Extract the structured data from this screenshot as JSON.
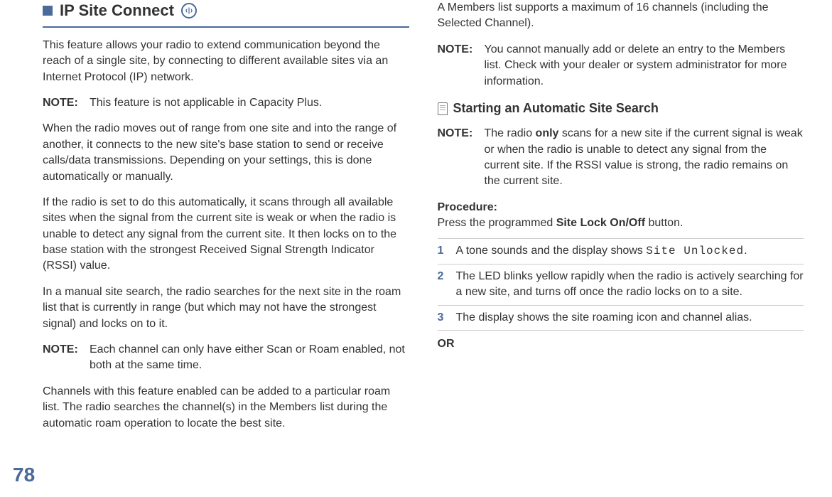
{
  "page_number": "78",
  "left": {
    "section_title": "IP Site Connect",
    "p1": "This feature allows your radio to extend communication beyond the reach of a single site, by connecting to different available sites via an Internet Protocol (IP) network.",
    "note1_label": "NOTE:",
    "note1_text": "This feature is not applicable in Capacity Plus.",
    "p2": "When the radio moves out of range from one site and into the range of another, it connects to the new site's base station to send or receive calls/data transmissions. Depending on your settings, this is done automatically or manually.",
    "p3": "If the radio is set to do this automatically, it scans through all available sites when the signal from the current site is weak or when the radio is unable to detect any signal from the current site. It then locks on to the base station with the strongest Received Signal Strength Indicator (RSSI) value.",
    "p4": "In a manual site search, the radio searches for the next site in the roam list that is currently in range (but which may not have the strongest signal) and locks on to it.",
    "note2_label": "NOTE:",
    "note2_text": "Each channel can only have either Scan or Roam enabled, not both at the same time.",
    "p5": "Channels with this feature enabled can be added to a particular roam list. The radio searches the channel(s) in the Members list during the automatic roam operation to locate the best site."
  },
  "right": {
    "p1": "A Members list supports a maximum of 16 channels (including the Selected Channel).",
    "note1_label": "NOTE:",
    "note1_text": "You cannot manually add or delete an entry to the Members list. Check with your dealer or system administrator for more information.",
    "sub_title": "Starting an Automatic Site Search",
    "note2_label": "NOTE:",
    "note2_pre": "The radio ",
    "note2_bold": "only",
    "note2_post": " scans for a new site if the current signal is weak or when the radio is unable to detect any signal from the current site. If the RSSI value is strong, the radio remains on the current site.",
    "proc_label": "Procedure:",
    "proc_pre": "Press the programmed ",
    "proc_bold": "Site Lock On/Off",
    "proc_post": " button.",
    "steps": [
      {
        "num": "1",
        "pre": "A tone sounds and the display shows ",
        "mono": "Site Unlocked",
        "post": "."
      },
      {
        "num": "2",
        "pre": "The LED blinks yellow rapidly when the radio is actively searching for a new site, and turns off once the radio locks on to a site.",
        "mono": "",
        "post": ""
      },
      {
        "num": "3",
        "pre": "The display shows the site roaming icon and channel alias.",
        "mono": "",
        "post": ""
      }
    ],
    "or": "OR"
  }
}
